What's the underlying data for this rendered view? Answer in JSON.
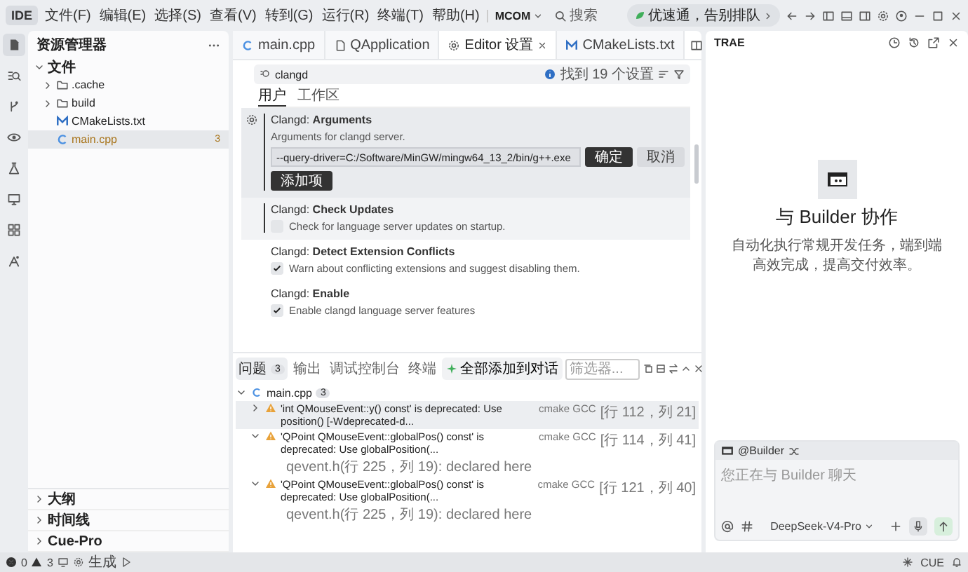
{
  "title_bar": {
    "app": "IDE",
    "menus": [
      "文件(F)",
      "编辑(E)",
      "选择(S)",
      "查看(V)",
      "转到(G)",
      "运行(R)",
      "终端(T)",
      "帮助(H)"
    ],
    "project": "MCOM",
    "search_placeholder": "搜索",
    "promo": "优速通，告别排队"
  },
  "activity_bar": [
    {
      "kind": "files",
      "selected": true
    },
    {
      "kind": "search",
      "selected": false
    },
    {
      "kind": "branch",
      "selected": false
    },
    {
      "kind": "eye",
      "selected": false
    },
    {
      "kind": "flask",
      "selected": false
    },
    {
      "kind": "monitor",
      "selected": false
    },
    {
      "kind": "grid",
      "selected": false
    },
    {
      "kind": "figure",
      "selected": false
    }
  ],
  "explorer": {
    "title": "资源管理器",
    "tree": [
      {
        "label": "文件",
        "kind": "root",
        "expanded": true,
        "selected": false,
        "children": [
          {
            "label": ".cache",
            "kind": "folder",
            "expanded": false,
            "selected": false
          },
          {
            "label": "build",
            "kind": "folder",
            "expanded": false,
            "selected": false
          },
          {
            "label": "CMakeLists.txt",
            "kind": "cmake",
            "selected": false
          },
          {
            "label": "main.cpp",
            "kind": "cpp",
            "selected": true,
            "badge": "3"
          }
        ]
      }
    ],
    "sections": [
      {
        "label": "大纲",
        "expanded": false
      },
      {
        "label": "时间线",
        "expanded": false
      },
      {
        "label": "Cue-Pro",
        "expanded": false
      }
    ]
  },
  "tabs": [
    {
      "label": "main.cpp",
      "kind": "cpp",
      "selected": false
    },
    {
      "label": "QApplication",
      "kind": "file",
      "selected": false
    },
    {
      "label": "Editor 设置",
      "kind": "settings",
      "selected": true
    },
    {
      "label": "CMakeLists.txt",
      "kind": "cmake",
      "selected": false
    }
  ],
  "settings": {
    "search": "clangd",
    "result": "找到 19 个设置",
    "scopes": [
      {
        "label": "用户",
        "selected": true
      },
      {
        "label": "工作区",
        "selected": false
      }
    ],
    "items": [
      {
        "kind": "list",
        "title": "Clangd: **Arguments**",
        "description": "Arguments for clangd server.",
        "value": "--query-driver=C:/Software/MinGW/mingw64_13_2/bin/g++.exe",
        "ok": "确定",
        "cancel": "取消",
        "add": "添加项",
        "focused": true,
        "hovered": false
      },
      {
        "kind": "checkbox",
        "title": "Clangd: **Check Updates**",
        "description": "Check for language server updates on startup.",
        "checked": false,
        "focused": false,
        "hovered": true
      },
      {
        "kind": "checkbox",
        "title": "Clangd: **Detect Extension Conflicts**",
        "description": "Warn about conflicting extensions and suggest disabling them.",
        "checked": true,
        "focused": false,
        "hovered": false
      },
      {
        "kind": "checkbox",
        "title": "Clangd: **Enable**",
        "description": "Enable clangd language server features",
        "checked": true,
        "focused": false,
        "hovered": false
      }
    ]
  },
  "panel": {
    "tabs": [
      {
        "label": "问题",
        "count": "3",
        "selected": true
      },
      {
        "label": "输出",
        "selected": false
      },
      {
        "label": "调试控制台",
        "selected": false
      },
      {
        "label": "终端",
        "selected": false
      }
    ],
    "action": "全部添加到对话",
    "filter_placeholder": "筛选器...",
    "file": "main.cpp",
    "file_count": "3",
    "problems": [
      {
        "message": "'int QMouseEvent::y() const' is deprecated: Use position() [-Wdeprecated-d...",
        "source": "cmake GCC",
        "location": "[行 112，列 21]",
        "expanded": false,
        "selected": true
      },
      {
        "message": "'QPoint QMouseEvent::globalPos() const' is deprecated: Use globalPosition(...",
        "source": "cmake GCC",
        "location": "[行 114，列 41]",
        "expanded": true,
        "selected": false,
        "detail": "qevent.h(行 225，列 19): declared here"
      },
      {
        "message": "'QPoint QMouseEvent::globalPos() const' is deprecated: Use globalPosition(...",
        "source": "cmake GCC",
        "location": "[行 121，列 40]",
        "expanded": true,
        "selected": false,
        "detail": "qevent.h(行 225，列 19): declared here"
      }
    ]
  },
  "assistant": {
    "title": "TRAE",
    "heading": "与 Builder 协作",
    "description": "自动化执行常规开发任务，端到端高效完成，提高交付效率。",
    "agent": "@Builder",
    "placeholder": "您正在与 Builder 聊天",
    "model": "DeepSeek-V4-Pro"
  },
  "status_bar": {
    "errors": "0",
    "warnings": "3",
    "build": "生成",
    "cue": "CUE"
  }
}
